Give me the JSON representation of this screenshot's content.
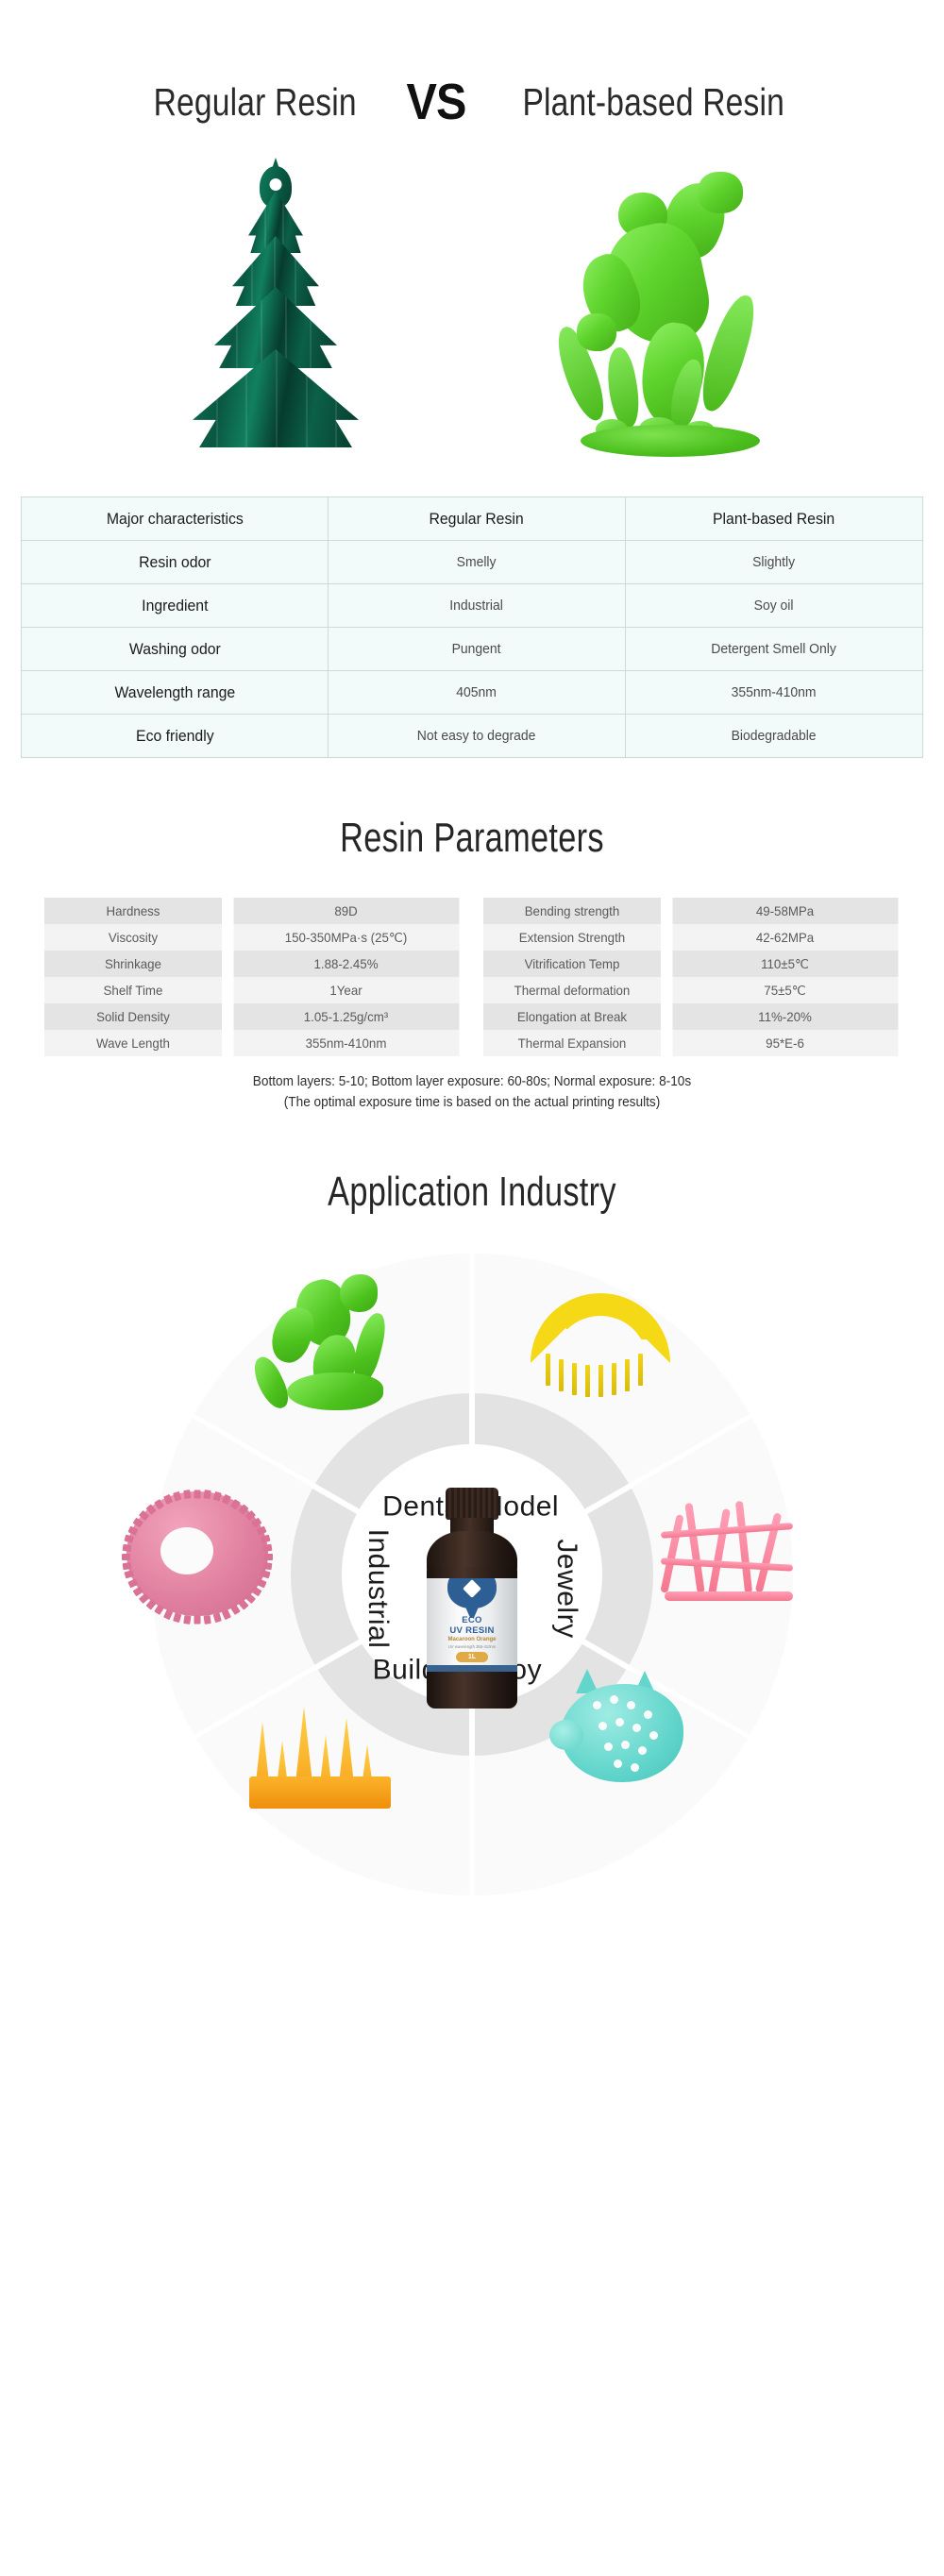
{
  "hero": {
    "left_title": "Regular Resin",
    "vs": "VS",
    "right_title": "Plant-based Resin",
    "left_model_name": "christmas-tree-model",
    "right_model_name": "green-hero-figure-model"
  },
  "comparison_table": {
    "headers": [
      "Major characteristics",
      "Regular Resin",
      "Plant-based Resin"
    ],
    "rows": [
      {
        "characteristic": "Resin odor",
        "regular": "Smelly",
        "plant": "Slightly"
      },
      {
        "characteristic": "Ingredient",
        "regular": "Industrial",
        "plant": "Soy oil"
      },
      {
        "characteristic": "Washing odor",
        "regular": "Pungent",
        "plant": "Detergent Smell Only"
      },
      {
        "characteristic": "Wavelength range",
        "regular": "405nm",
        "plant": "355nm-410nm"
      },
      {
        "characteristic": "Eco friendly",
        "regular": "Not easy to degrade",
        "plant": "Biodegradable"
      }
    ]
  },
  "parameters": {
    "title": "Resin Parameters",
    "left_rows": [
      {
        "key": "Hardness",
        "value": "89D"
      },
      {
        "key": "Viscosity",
        "value": "150-350MPa·s (25℃)"
      },
      {
        "key": "Shrinkage",
        "value": "1.88-2.45%"
      },
      {
        "key": "Shelf Time",
        "value": "1Year"
      },
      {
        "key": "Solid Density",
        "value": "1.05-1.25g/cm³"
      },
      {
        "key": "Wave Length",
        "value": "355nm-410nm"
      }
    ],
    "right_rows": [
      {
        "key": "Bending strength",
        "value": "49-58MPa"
      },
      {
        "key": "Extension Strength",
        "value": "42-62MPa"
      },
      {
        "key": "Vitrification Temp",
        "value": "110±5℃"
      },
      {
        "key": "Thermal deformation",
        "value": "75±5℃"
      },
      {
        "key": "Elongation at Break",
        "value": "11%-20%"
      },
      {
        "key": "Thermal Expansion",
        "value": "95*E-6"
      }
    ],
    "footnote_line1": "Bottom layers: 5-10; Bottom layer exposure: 60-80s; Normal exposure: 8-10s",
    "footnote_line2": "(The optimal exposure time is based on the actual printing results)"
  },
  "applications": {
    "title": "Application Industry",
    "segments": [
      {
        "label": "Model",
        "model": "green-figure-model",
        "color": "#4dc21d"
      },
      {
        "label": "Dental",
        "model": "yellow-dental-model",
        "color": "#f5d916"
      },
      {
        "label": "Jewelry",
        "model": "pink-jewelry-model",
        "color": "#f4788f"
      },
      {
        "label": "Toy",
        "model": "cyan-piggy-model",
        "color": "#63d6cc"
      },
      {
        "label": "Building",
        "model": "orange-castle-model",
        "color": "#f59a13"
      },
      {
        "label": "Industrial",
        "model": "pink-gear-model",
        "color": "#e07f9f"
      }
    ],
    "bottle": {
      "brand_line1": "ECO",
      "brand_line2": "UV RESIN",
      "variant": "Macaroon Orange",
      "wavelength": "UV wavelength 355-410nm",
      "volume": "1L"
    }
  },
  "colors": {
    "table_bg": "#f3fafa",
    "table_border": "#cfd9d9",
    "param_band_dark": "#e4e4e4",
    "param_band_light": "#f3f3f3",
    "wheel_ring": "#e3e3e3",
    "wheel_bg": "#fafafa",
    "bottle_label_blue": "#2f5f94",
    "bottle_volume_badge": "#e0ab46"
  }
}
